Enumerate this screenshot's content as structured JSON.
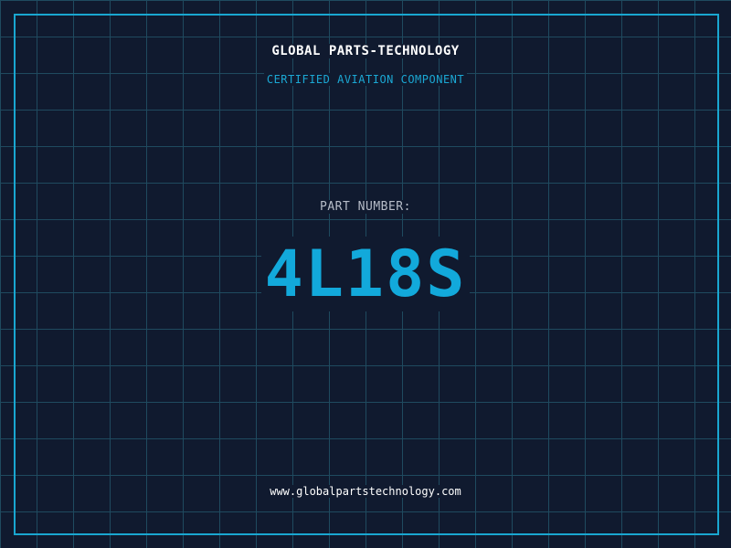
{
  "header": {
    "company_name": "GLOBAL PARTS-TECHNOLOGY",
    "subtitle": "CERTIFIED AVIATION COMPONENT"
  },
  "part": {
    "label": "PART NUMBER:",
    "number": "4L18S"
  },
  "footer": {
    "website": "www.globalpartstechnology.com"
  },
  "colors": {
    "background": "#101a2f",
    "grid": "#1f4a5f",
    "accent": "#19a7d1",
    "text_primary": "#ffffff",
    "text_muted": "#b6bcc8"
  }
}
